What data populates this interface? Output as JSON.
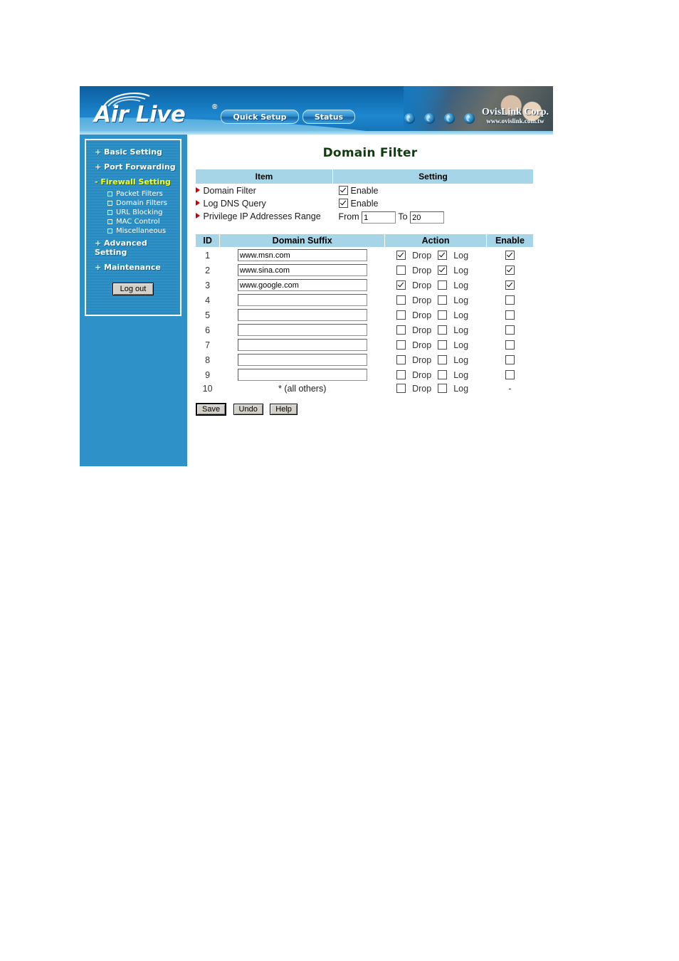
{
  "banner": {
    "logo_text": "Air Live",
    "logo_registered": "®",
    "quick_setup_label": "Quick Setup",
    "status_label": "Status",
    "company": "OvisLink Corp.",
    "company_url": "www.ovislink.com.tw",
    "globe_icons": [
      "globe-icon",
      "globe-icon",
      "globe-icon",
      "globe-icon"
    ]
  },
  "sidebar": {
    "items": [
      {
        "label": "+ Basic Setting",
        "active": false
      },
      {
        "label": "+ Port Forwarding",
        "active": false
      },
      {
        "label": "- Firewall Setting",
        "active": true
      }
    ],
    "subitems": [
      {
        "label": "Packet Filters"
      },
      {
        "label": "Domain Filters"
      },
      {
        "label": "URL Blocking"
      },
      {
        "label": "MAC Control"
      },
      {
        "label": "Miscellaneous"
      }
    ],
    "items_after": [
      {
        "label": "+ Advanced Setting",
        "active": false
      },
      {
        "label": "+ Maintenance",
        "active": false
      }
    ],
    "logout_label": "Log out",
    "active_color": "#ffff00",
    "background_color": "#2e92c8"
  },
  "content": {
    "title": "Domain Filter",
    "title_color": "#103d10",
    "header_color": "#a6d5e8",
    "settings_headers": {
      "item": "Item",
      "setting": "Setting"
    },
    "settings_rows": [
      {
        "item": "Domain Filter",
        "type": "checkbox",
        "checked": true,
        "label": "Enable"
      },
      {
        "item": "Log DNS Query",
        "type": "checkbox",
        "checked": true,
        "label": "Enable"
      },
      {
        "item": "Privilege IP Addresses Range",
        "type": "range",
        "from_label": "From",
        "from_value": "1",
        "to_label": "To",
        "to_value": "20"
      }
    ],
    "filter_headers": {
      "id": "ID",
      "suffix": "Domain Suffix",
      "action": "Action",
      "enable": "Enable"
    },
    "action_labels": {
      "drop": "Drop",
      "log": "Log"
    },
    "filter_rows": [
      {
        "id": "1",
        "suffix": "www.msn.com",
        "editable": true,
        "drop": true,
        "log": true,
        "enable": true,
        "enable_text": ""
      },
      {
        "id": "2",
        "suffix": "www.sina.com",
        "editable": true,
        "drop": false,
        "log": true,
        "enable": true,
        "enable_text": ""
      },
      {
        "id": "3",
        "suffix": "www.google.com",
        "editable": true,
        "drop": true,
        "log": false,
        "enable": true,
        "enable_text": ""
      },
      {
        "id": "4",
        "suffix": "",
        "editable": true,
        "drop": false,
        "log": false,
        "enable": false,
        "enable_text": ""
      },
      {
        "id": "5",
        "suffix": "",
        "editable": true,
        "drop": false,
        "log": false,
        "enable": false,
        "enable_text": ""
      },
      {
        "id": "6",
        "suffix": "",
        "editable": true,
        "drop": false,
        "log": false,
        "enable": false,
        "enable_text": ""
      },
      {
        "id": "7",
        "suffix": "",
        "editable": true,
        "drop": false,
        "log": false,
        "enable": false,
        "enable_text": ""
      },
      {
        "id": "8",
        "suffix": "",
        "editable": true,
        "drop": false,
        "log": false,
        "enable": false,
        "enable_text": ""
      },
      {
        "id": "9",
        "suffix": "",
        "editable": true,
        "drop": false,
        "log": false,
        "enable": false,
        "enable_text": ""
      },
      {
        "id": "10",
        "suffix": "* (all others)",
        "editable": false,
        "drop": false,
        "log": false,
        "enable": null,
        "enable_text": "-"
      }
    ],
    "buttons": [
      {
        "label": "Save",
        "default": true
      },
      {
        "label": "Undo",
        "default": false
      },
      {
        "label": "Help",
        "default": false
      }
    ]
  }
}
